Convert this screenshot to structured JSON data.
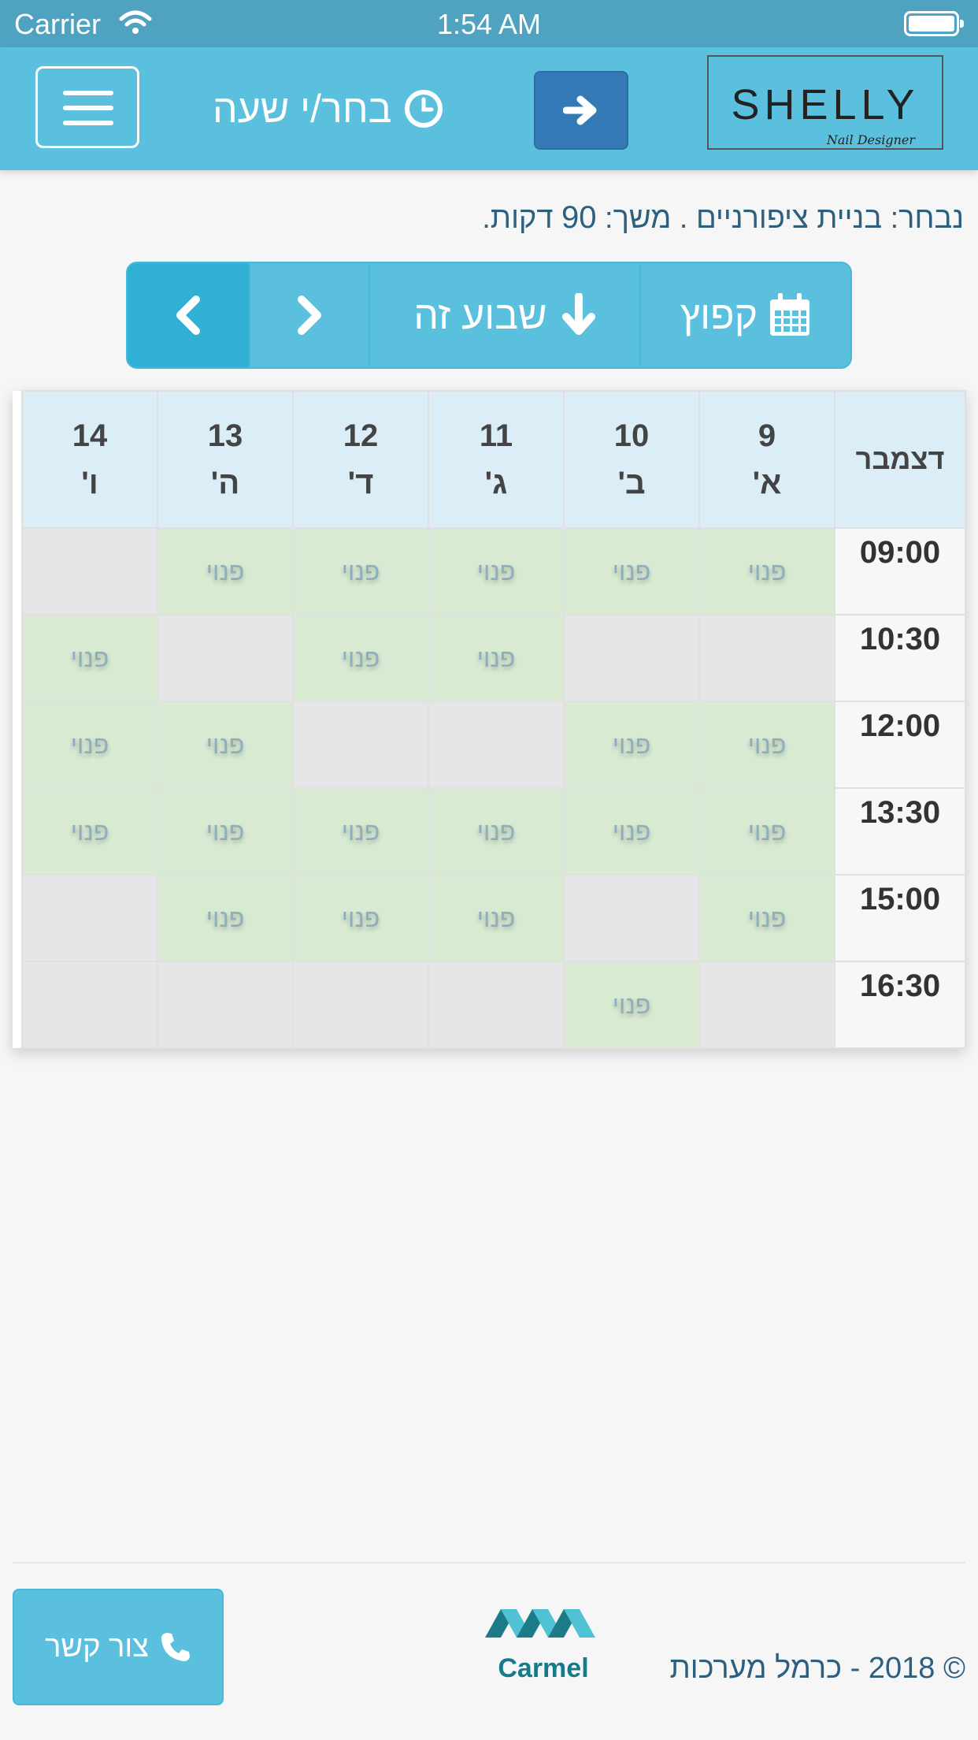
{
  "status_bar": {
    "carrier": "Carrier",
    "time": "1:54 AM"
  },
  "header": {
    "title": "בחר/י שעה",
    "logo_main": "SHELLY",
    "logo_sub": "Nail Designer"
  },
  "selected_info": {
    "prefix": "נבחר: בניית ציפורניים . משך: ",
    "duration": "90",
    "suffix": " דקות."
  },
  "nav": {
    "this_week": "שבוע זה",
    "jump": "קפוץ"
  },
  "schedule": {
    "month": "דצמבר",
    "days": [
      {
        "date": "9",
        "day": "א'"
      },
      {
        "date": "10",
        "day": "ב'"
      },
      {
        "date": "11",
        "day": "ג'"
      },
      {
        "date": "12",
        "day": "ד'"
      },
      {
        "date": "13",
        "day": "ה'"
      },
      {
        "date": "14",
        "day": "ו'"
      }
    ],
    "free_label": "פנוי",
    "rows": [
      {
        "time": "09:00",
        "slots": [
          true,
          true,
          true,
          true,
          true,
          false
        ]
      },
      {
        "time": "10:30",
        "slots": [
          false,
          false,
          true,
          true,
          false,
          true
        ]
      },
      {
        "time": "12:00",
        "slots": [
          true,
          true,
          false,
          false,
          true,
          true
        ]
      },
      {
        "time": "13:30",
        "slots": [
          true,
          true,
          true,
          true,
          true,
          true
        ]
      },
      {
        "time": "15:00",
        "slots": [
          true,
          false,
          true,
          true,
          true,
          false
        ]
      },
      {
        "time": "16:30",
        "slots": [
          false,
          true,
          false,
          false,
          false,
          false
        ]
      }
    ]
  },
  "footer": {
    "contact_label": "צור קשר",
    "carmel_text": "Carmel",
    "copyright": "© 2018 - כרמל מערכות"
  },
  "colors": {
    "header_bg": "#5bc0de",
    "status_bg": "#4fa3c0",
    "primary_btn": "#337ab7",
    "free_slot": "#d9ead3",
    "busy_slot": "#e6e6e6",
    "day_header": "#dbeef7"
  },
  "icons": [
    "wifi-icon",
    "battery-icon",
    "hamburger-icon",
    "clock-icon",
    "arrow-right-icon",
    "chevron-left-icon",
    "chevron-right-icon",
    "arrow-down-icon",
    "calendar-icon",
    "phone-icon"
  ]
}
